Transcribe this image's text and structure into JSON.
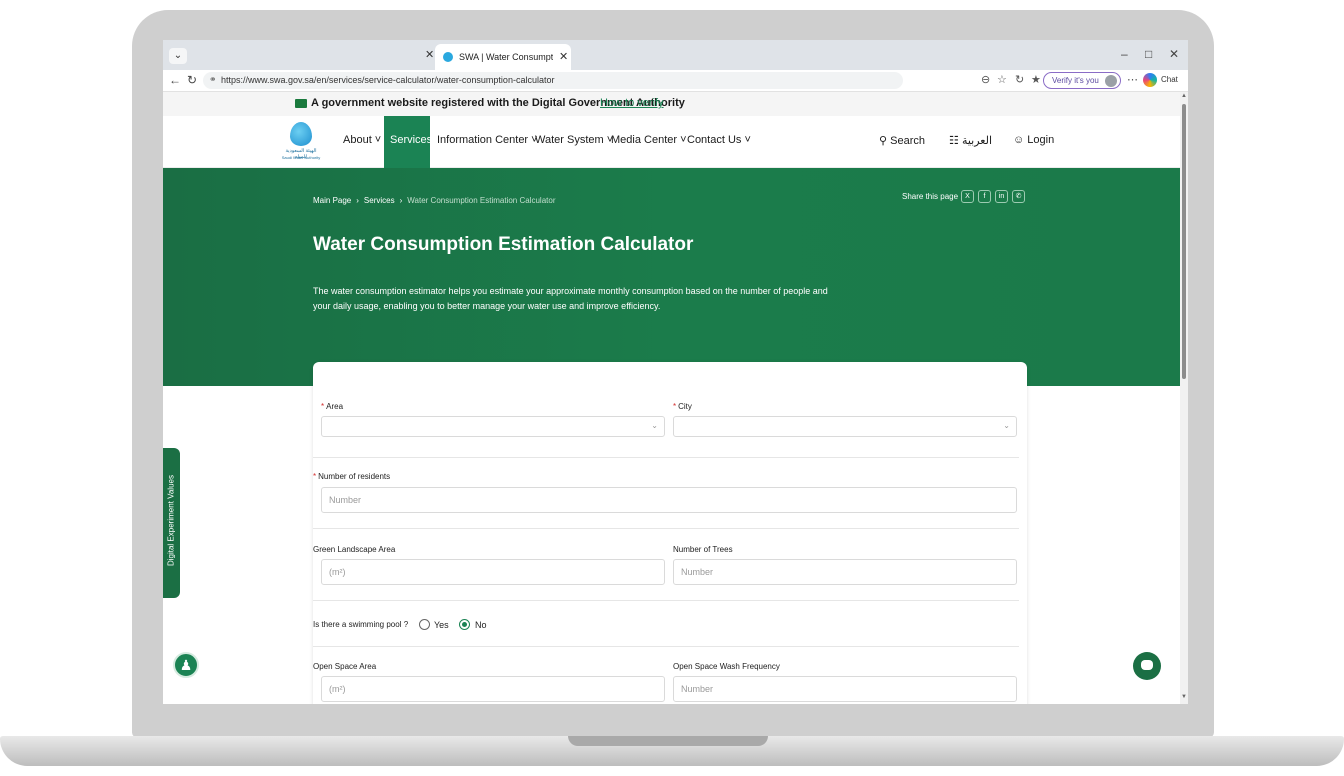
{
  "browser": {
    "tab_title": "SWA | Water Consumption Calcula",
    "url": "https://www.swa.gov.sa/en/services/service-calculator/water-consumption-calculator",
    "profile_label": "Verify it's you",
    "chat_label": "Chat"
  },
  "gov_banner": {
    "text": "A government website registered with the Digital Government Authority",
    "link": "How to verify"
  },
  "header": {
    "logo_ar": "الهيئة السعودية للمياه",
    "logo_en": "Saudi Water Authority",
    "nav": [
      "About",
      "Services",
      "Information Center",
      "Water System",
      "Media Center",
      "Contact Us"
    ],
    "search": "Search",
    "language": "العربية",
    "login": "Login"
  },
  "hero": {
    "breadcrumb": [
      "Main Page",
      "Services",
      "Water Consumption Estimation Calculator"
    ],
    "share_label": "Share this page :",
    "title": "Water Consumption Estimation Calculator",
    "description": "The water consumption estimator helps you estimate your approximate monthly consumption based on the number of people and your daily usage, enabling you to better manage your water use and improve efficiency."
  },
  "form": {
    "area_label": "Area",
    "city_label": "City",
    "residents_label": "Number of residents",
    "residents_placeholder": "Number",
    "green_area_label": "Green Landscape Area",
    "green_area_placeholder": "(m²)",
    "trees_label": "Number of Trees",
    "trees_placeholder": "Number",
    "pool_question": "Is there a swimming pool ?",
    "pool_yes": "Yes",
    "pool_no": "No",
    "pool_selected": "No",
    "open_space_label": "Open Space Area",
    "open_space_placeholder": "(m²)",
    "wash_freq_label": "Open Space Wash Frequency",
    "wash_freq_placeholder": "Number"
  },
  "side_tab": "Digital Experiment Values",
  "colors": {
    "brand_green": "#1b8354",
    "hero_green": "#1b7c4b"
  }
}
